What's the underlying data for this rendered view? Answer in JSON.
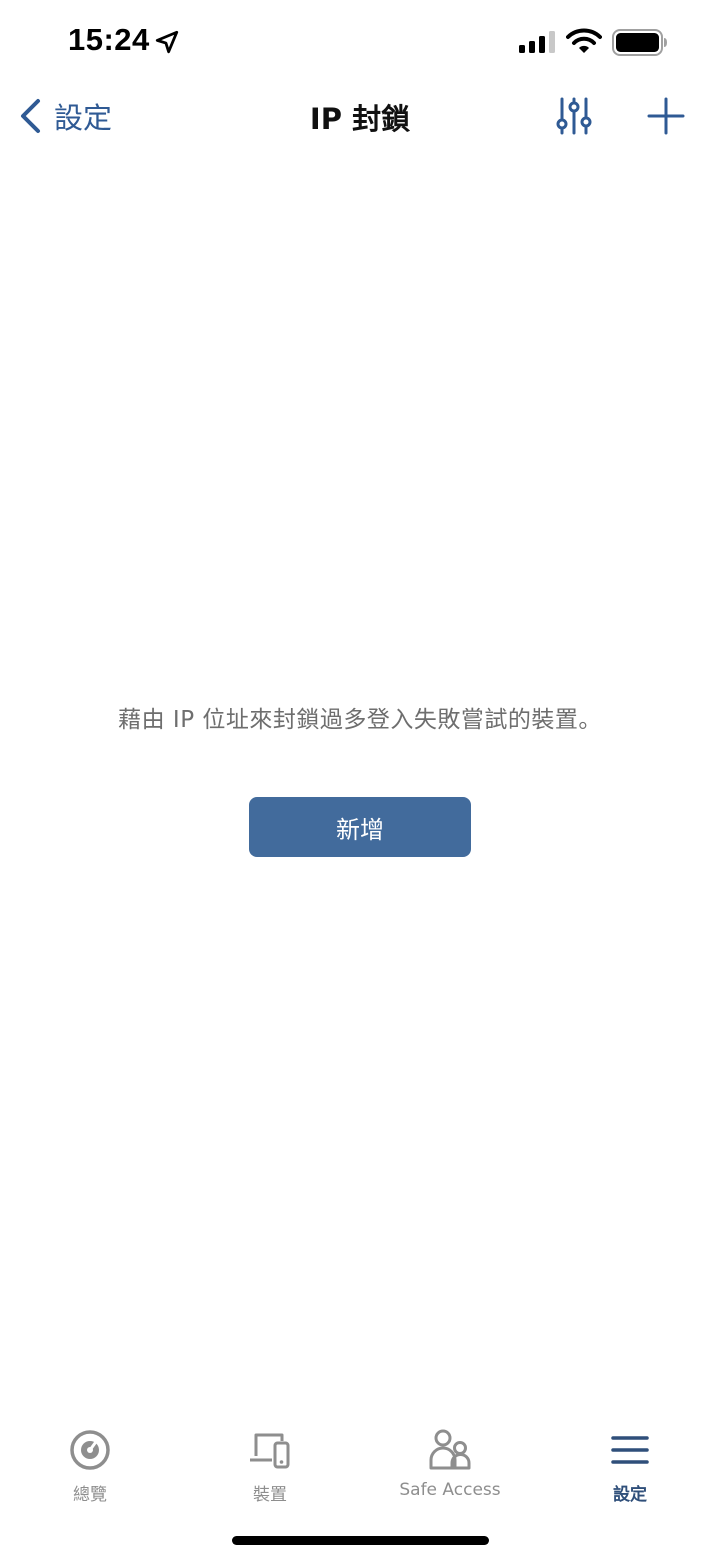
{
  "status_bar": {
    "time": "15:24",
    "icons": [
      "location-arrow-icon",
      "cellular-signal-icon",
      "wifi-icon",
      "battery-icon"
    ]
  },
  "nav": {
    "back_label": "設定",
    "title": "IP 封鎖",
    "back_icon": "chevron-left-icon",
    "filter_icon": "sliders-icon",
    "add_icon": "plus-icon"
  },
  "empty_state": {
    "message": "藉由 IP 位址來封鎖過多登入失敗嘗試的裝置。",
    "button_label": "新增"
  },
  "tabs": [
    {
      "label": "總覽",
      "icon": "gauge-icon",
      "active": false
    },
    {
      "label": "裝置",
      "icon": "devices-icon",
      "active": false
    },
    {
      "label": "Safe Access",
      "icon": "family-users-icon",
      "active": false
    },
    {
      "label": "設定",
      "icon": "menu-icon",
      "active": true
    }
  ],
  "colors": {
    "accent": "#2f5a94",
    "button_bg": "#426b9c",
    "active_tab": "#2f4f7a",
    "inactive_tab": "#8e8e8e",
    "message_text": "#6e6e6e"
  }
}
